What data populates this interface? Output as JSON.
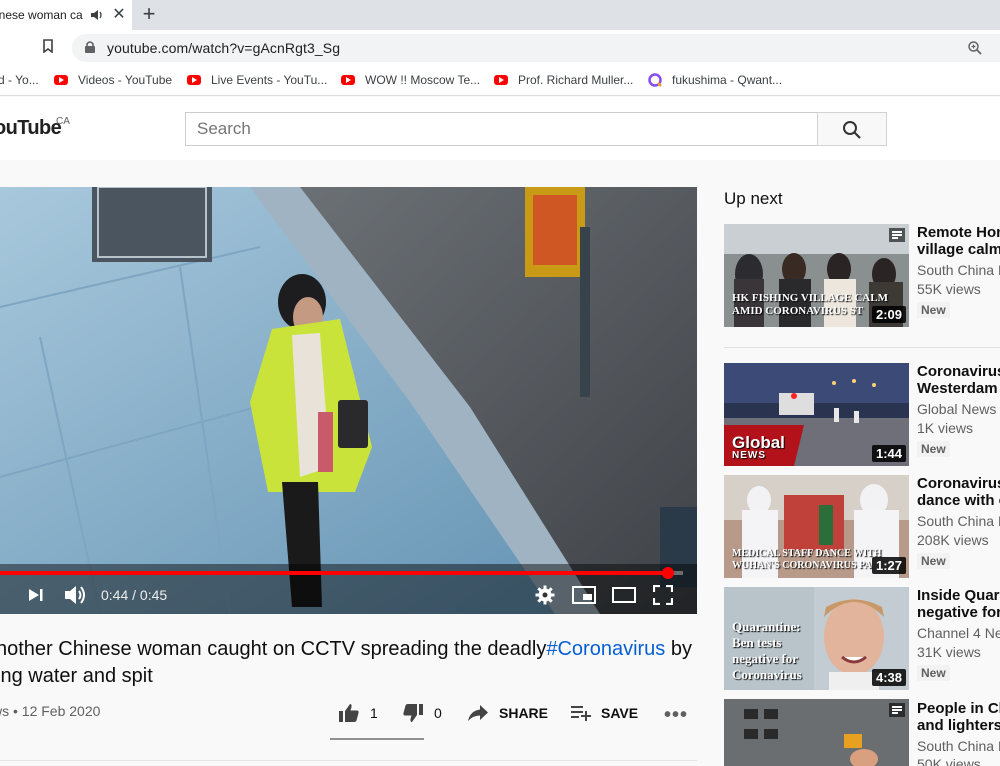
{
  "browser": {
    "tab_title": "inese woman ca",
    "new_tab": "+",
    "close": "✕",
    "url": "youtube.com/watch?v=gAcnRgt3_Sg",
    "bookmarks": [
      {
        "label": "d - Yo..."
      },
      {
        "label": "Videos - YouTube"
      },
      {
        "label": "Live Events - YouTu..."
      },
      {
        "label": "WOW !! Moscow Te..."
      },
      {
        "label": "Prof. Richard Muller..."
      },
      {
        "label": "fukushima - Qwant..."
      }
    ]
  },
  "masthead": {
    "logo": "ouTube",
    "country": "CA",
    "search_placeholder": "Search"
  },
  "player": {
    "current_time": "0:44",
    "duration": "0:45",
    "time_display": "0:44 / 0:45",
    "progress_fraction": 0.978
  },
  "video": {
    "title_prefix": "nother Chinese woman caught on CCTV spreading the deadly",
    "hashtag": "#Coronavirus",
    "title_suffix": " by",
    "title_line2": "ing water and spit",
    "meta": "ws • 12 Feb 2020",
    "likes": "1",
    "dislikes": "0",
    "share_label": "SHARE",
    "save_label": "SAVE"
  },
  "upnext": {
    "heading": "Up next",
    "items": [
      {
        "title1": "Remote Hon",
        "title2": "village calm",
        "channel": "South China M",
        "views": "55K views",
        "badge": "New",
        "duration": "2:09",
        "caption1": "HK FISHING VILLAGE CALM",
        "caption2": "AMID CORONAVIRUS ST"
      },
      {
        "title1": "Coronavirus",
        "title2": "Westerdam c",
        "channel": "Global News",
        "views": "1K views",
        "badge": "New",
        "duration": "1:44",
        "caption1": "Global",
        "caption2": "NEWS"
      },
      {
        "title1": "Coronavirus",
        "title2": "dance with c",
        "channel": "South China M",
        "views": "208K views",
        "badge": "New",
        "duration": "1:27",
        "caption1": "MEDICAL STAFF DANCE WITH",
        "caption2": "WUHAN'S CORONAVIRUS PA"
      },
      {
        "title1": "Inside Quara",
        "title2": "negative for",
        "channel": "Channel 4 Ne",
        "views": "31K views",
        "badge": "New",
        "duration": "4:38",
        "caption_lines": [
          "Quarantine:",
          "Ben tests",
          "negative for",
          "Coronavirus"
        ]
      },
      {
        "title1": "People in Ch",
        "title2": "and lighters",
        "channel": "South China M",
        "views": "50K views"
      }
    ]
  },
  "colors": {
    "progress_red": "#ff0000",
    "link_blue": "#065fd4",
    "jacket_yellow": "#c9e33a"
  }
}
